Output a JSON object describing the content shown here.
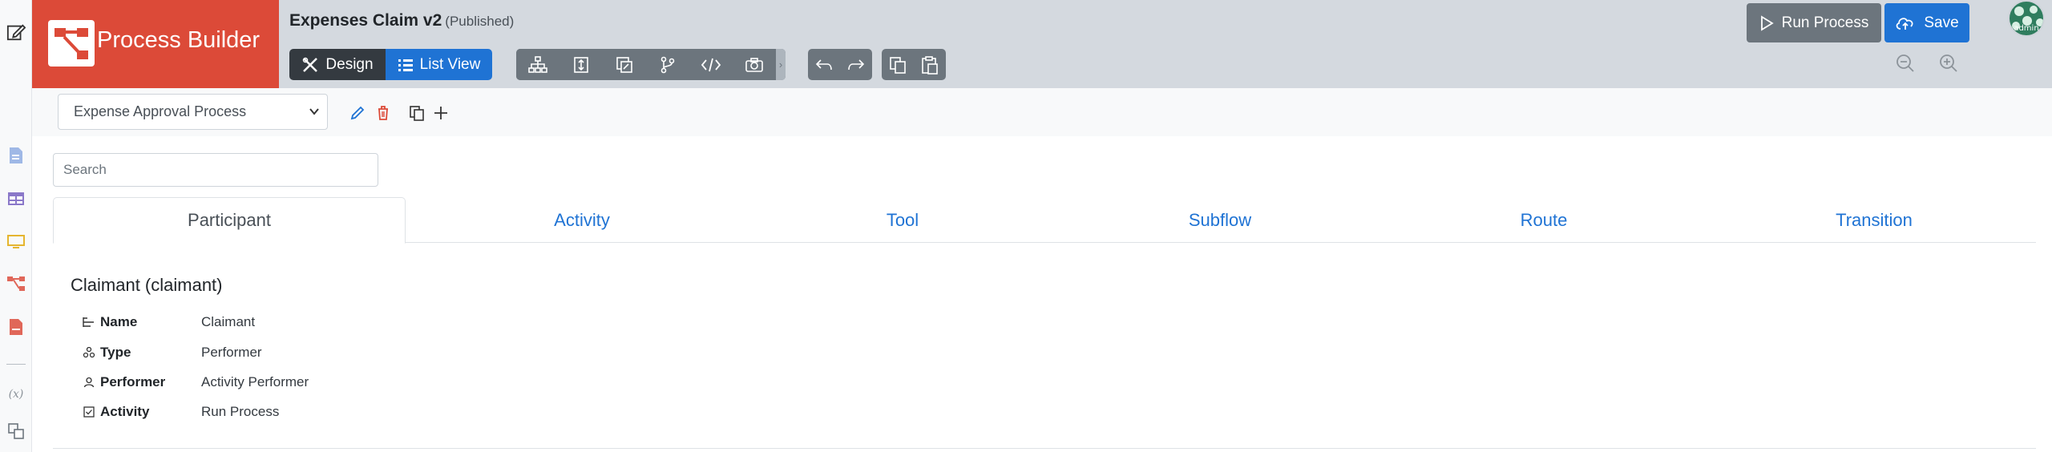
{
  "brand": {
    "title": "Process Builder",
    "color": "#dc4a38"
  },
  "document": {
    "title": "Expenses Claim v2",
    "status": "(Published)"
  },
  "mode": {
    "design_label": "Design",
    "list_view_label": "List View"
  },
  "toolbar": {
    "tools": [
      "sitemap-icon",
      "fit-vertical-icon",
      "image-edit-icon",
      "branch-icon",
      "code-icon",
      "camera-icon"
    ],
    "more": "›",
    "undo_icon": "undo-icon",
    "redo_icon": "redo-icon",
    "copy_icon": "copy-icon",
    "paste_icon": "paste-icon"
  },
  "actions": {
    "run_label": "Run Process",
    "save_label": "Save"
  },
  "user": {
    "avatar_text": "admin"
  },
  "process": {
    "selected": "Expense Approval Process"
  },
  "search": {
    "placeholder": "Search"
  },
  "tabs": [
    {
      "label": "Participant",
      "active": true
    },
    {
      "label": "Activity"
    },
    {
      "label": "Tool"
    },
    {
      "label": "Subflow"
    },
    {
      "label": "Route"
    },
    {
      "label": "Transition"
    }
  ],
  "detail": {
    "title": "Claimant (claimant)",
    "properties": [
      {
        "label": "Name",
        "value": "Claimant",
        "icon": "list-icon"
      },
      {
        "label": "Type",
        "value": "Performer",
        "icon": "nodes-icon"
      },
      {
        "label": "Performer",
        "value": "Activity Performer",
        "icon": "user-icon"
      },
      {
        "label": "Activity",
        "value": "Run Process",
        "icon": "checkbox-icon"
      }
    ]
  },
  "colors": {
    "header_bg": "#d4d9df",
    "primary": "#1f73d4",
    "dark": "#343a40",
    "secondary": "#6c757d"
  }
}
